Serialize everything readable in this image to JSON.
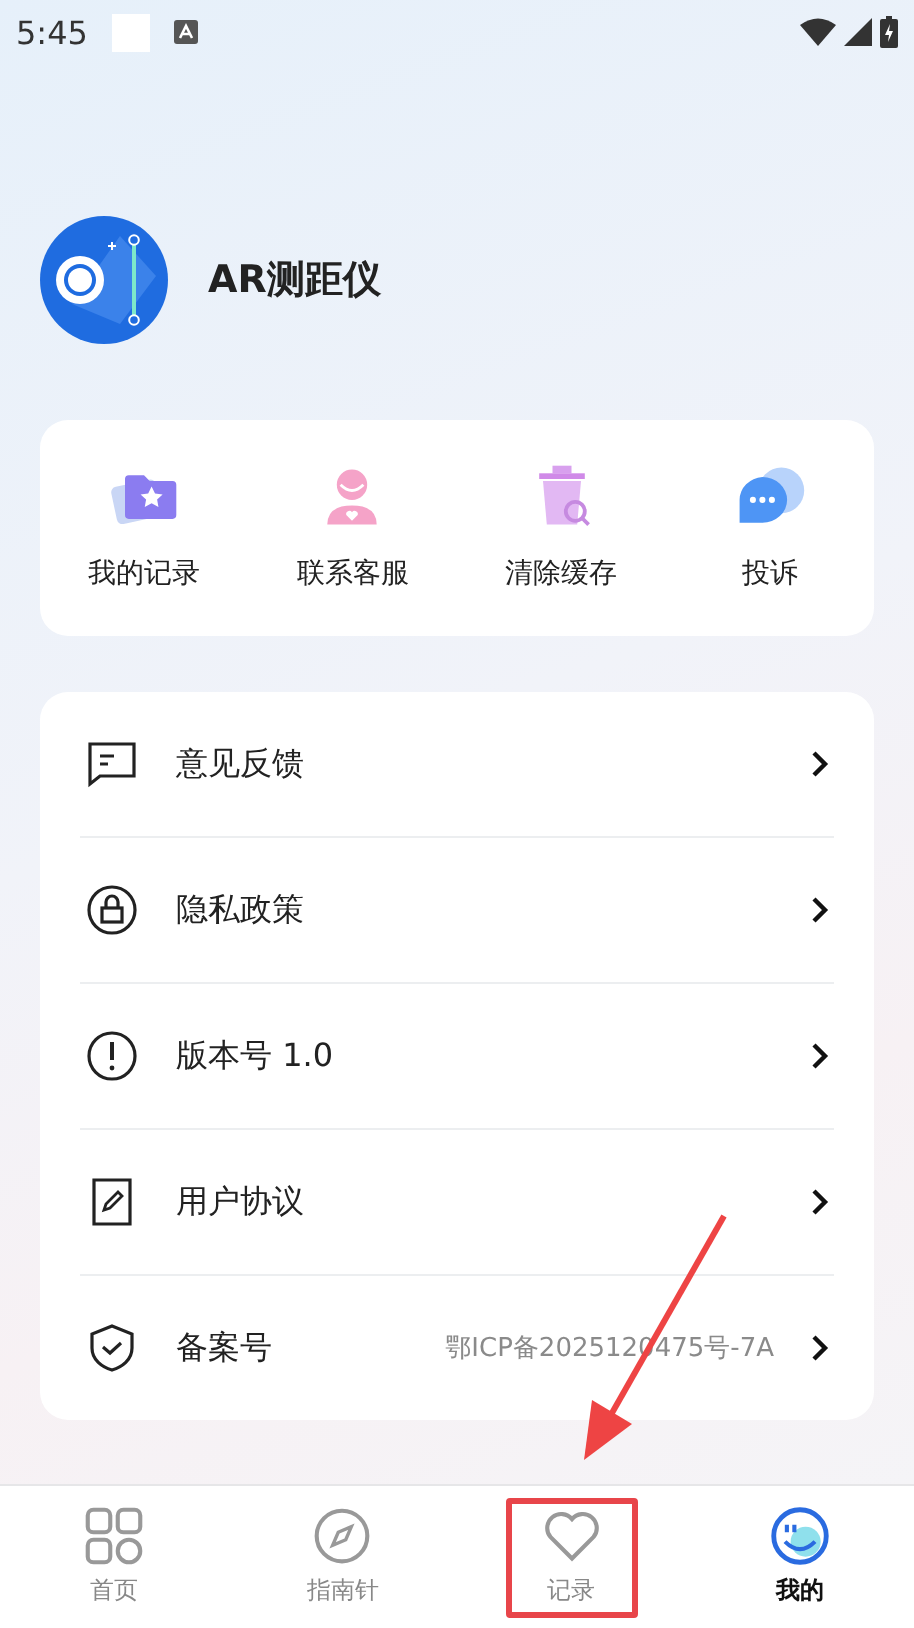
{
  "status_bar": {
    "time": "5:45"
  },
  "app": {
    "name": "AR测距仪"
  },
  "shortcuts": [
    {
      "label": "我的记录",
      "kind": "records"
    },
    {
      "label": "联系客服",
      "kind": "support"
    },
    {
      "label": "清除缓存",
      "kind": "clear"
    },
    {
      "label": "投诉",
      "kind": "complaint"
    }
  ],
  "menu": [
    {
      "label": "意见反馈",
      "kind": "feedback"
    },
    {
      "label": "隐私政策",
      "kind": "privacy"
    },
    {
      "label": "版本号 1.0",
      "kind": "version"
    },
    {
      "label": "用户协议",
      "kind": "agreement"
    },
    {
      "label": "备案号",
      "kind": "filing",
      "value": "鄂ICP备2025120475号-7A"
    }
  ],
  "tabs": [
    {
      "label": "首页",
      "kind": "home",
      "selected": false,
      "highlighted": false
    },
    {
      "label": "指南针",
      "kind": "compass",
      "selected": false,
      "highlighted": false
    },
    {
      "label": "记录",
      "kind": "heart",
      "selected": false,
      "highlighted": true
    },
    {
      "label": "我的",
      "kind": "me",
      "selected": true,
      "highlighted": false
    }
  ],
  "annotations": {
    "arrow": true
  }
}
